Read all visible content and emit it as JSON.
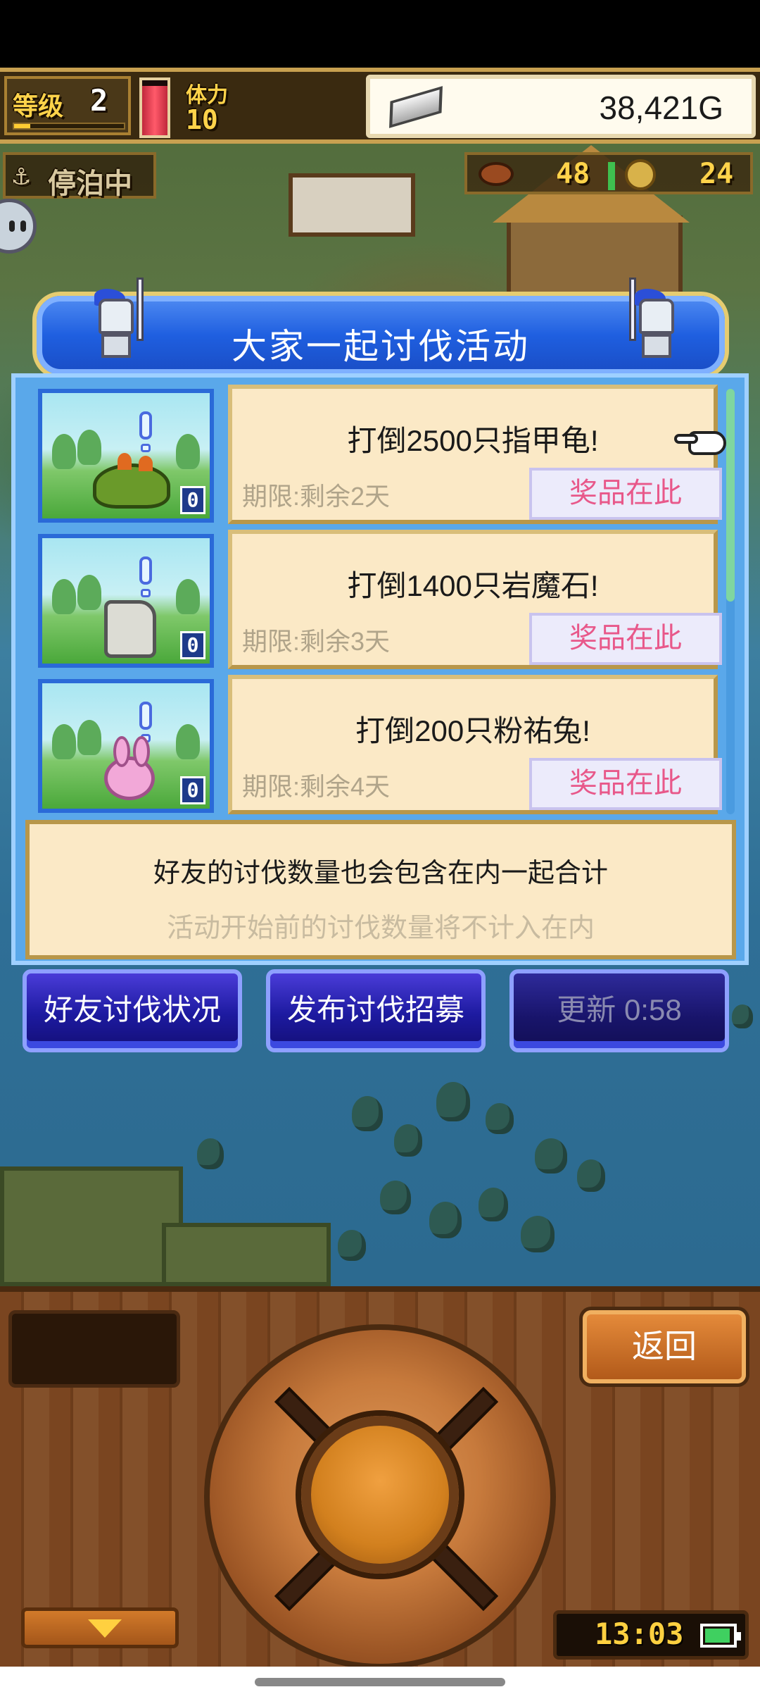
{
  "hud": {
    "level_label": "等级",
    "level_value": "2",
    "exp_fraction": 0.15,
    "hp_fraction": 0.9,
    "stamina_label": "体力",
    "stamina_value": "10",
    "gold": "38,421G",
    "status_label": "停泊中",
    "resource_food": "48",
    "resource_coins": "24",
    "icons": [
      "silver-bar-icon",
      "meat-icon",
      "coin-icon",
      "anchor-icon",
      "chat-bubble-icon"
    ]
  },
  "panel": {
    "title": "大家一起讨伐活动",
    "events": [
      {
        "title": "打倒2500只指甲龟!",
        "deadline": "期限:剩余2天",
        "prize_label": "奖品在此",
        "count": "0",
        "monster_icon": "turtle-monster-icon"
      },
      {
        "title": "打倒1400只岩魔石!",
        "deadline": "期限:剩余3天",
        "prize_label": "奖品在此",
        "count": "0",
        "monster_icon": "rock-golem-monster-icon"
      },
      {
        "title": "打倒200只粉祐兔!",
        "deadline": "期限:剩余4天",
        "prize_label": "奖品在此",
        "count": "0",
        "monster_icon": "pink-rabbit-monster-icon"
      }
    ],
    "scroll_fraction": 0.5,
    "note_main": "好友的讨伐数量也会包含在内一起合计",
    "note_sub": "活动开始前的讨伐数量将不计入在内"
  },
  "actions": {
    "friends_status": "好友讨伐状况",
    "post_recruit": "发布讨伐招募",
    "refresh": "更新 0:58"
  },
  "console": {
    "back_label": "返回",
    "clock": "13:03",
    "battery_fraction": 0.8
  },
  "colors": {
    "panel_blue": "#1f5fe0",
    "card_cream": "#fbe9c6",
    "prize_pink": "#e8588a",
    "button_navy": "#1d1aa0",
    "wood_brown": "#7a4520",
    "gold_text": "#ffd34a"
  }
}
